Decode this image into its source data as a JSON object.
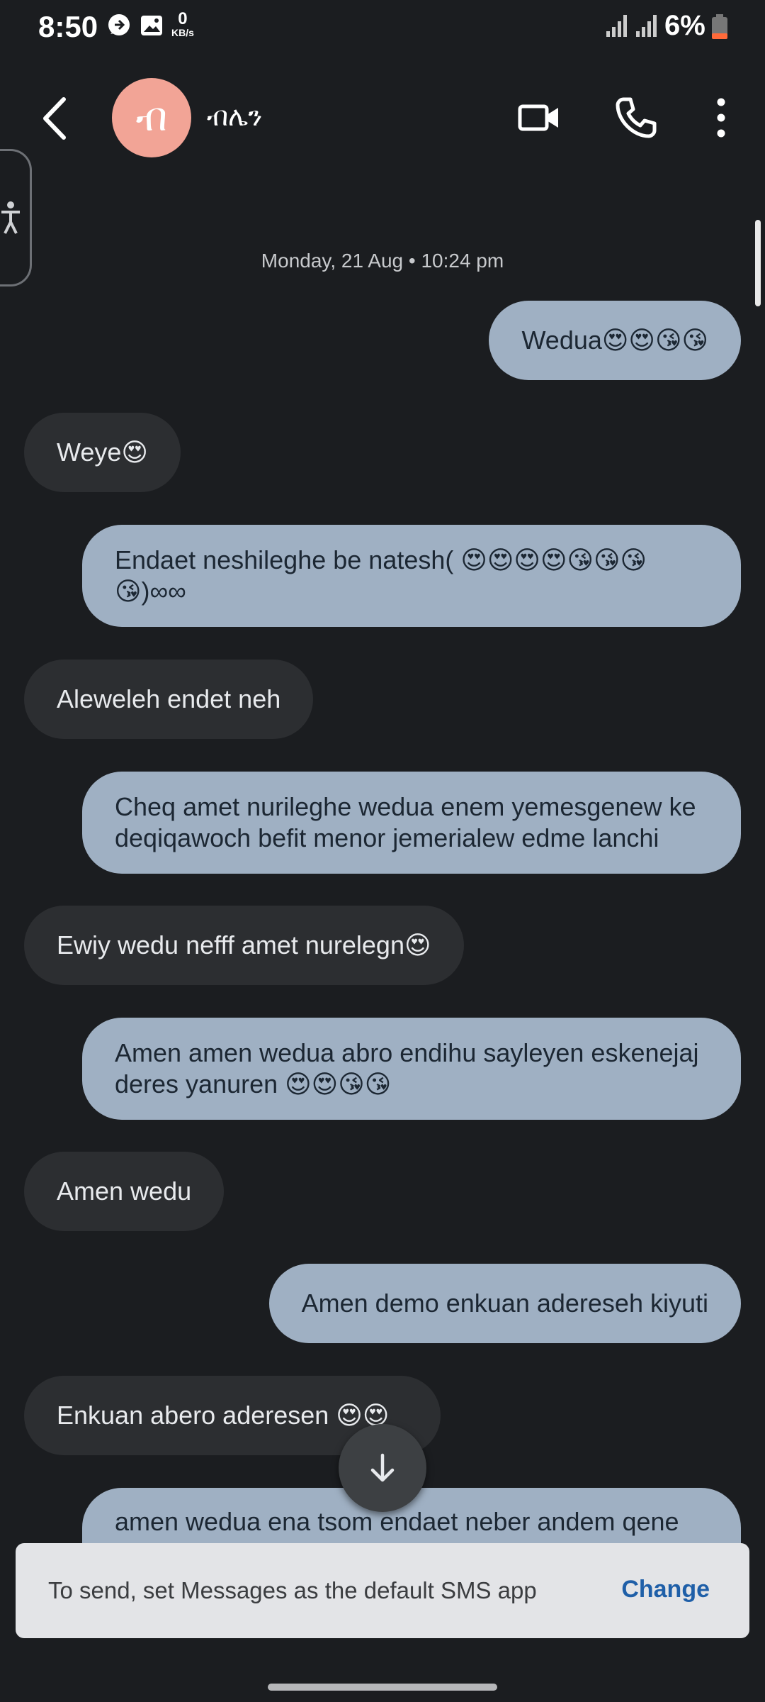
{
  "status_bar": {
    "time": "8:50",
    "net_speed": "0",
    "net_unit": "KB/s",
    "battery": "6%"
  },
  "header": {
    "avatar_letter": "ብ",
    "contact_name": "ብሌን"
  },
  "conversation": {
    "date": "Monday, 21 Aug • 10:24 pm",
    "messages": [
      {
        "dir": "sent",
        "text": "Wedua😍😍😘😘"
      },
      {
        "dir": "recv",
        "text": "Weye😍"
      },
      {
        "dir": "sent",
        "text": "Endaet neshileghe be natesh( 😍😍😍😍😘😘😘 😘)∞∞"
      },
      {
        "dir": "recv",
        "text": "Aleweleh endet neh"
      },
      {
        "dir": "sent",
        "text": "Cheq amet nurileghe wedua enem yemesgenew ke deqiqawoch befit menor jemerialew edme lanchi"
      },
      {
        "dir": "recv",
        "text": "Ewiy wedu nefff amet nurelegn😍"
      },
      {
        "dir": "sent",
        "text": "Amen amen wedua abro endihu sayleyen eskenejaj deres yanuren 😍😍😘😘"
      },
      {
        "dir": "recv",
        "text": "Amen wedu"
      },
      {
        "dir": "sent",
        "text": "Amen demo enkuan adereseh kiyuti"
      },
      {
        "dir": "recv",
        "text": "Enkuan abero aderesen 😍😍"
      },
      {
        "dir": "sent",
        "text": "amen wedua ena tsom endaet neber andem qene"
      }
    ]
  },
  "snackbar": {
    "message": "To send, set Messages as the default SMS app",
    "action": "Change"
  },
  "colors": {
    "background": "#1b1d20",
    "sent_bubble": "#9fb0c3",
    "received_bubble": "#2c2e31",
    "avatar": "#f2a496",
    "action_blue": "#1f5fa8"
  },
  "icons": [
    "message-notification-icon",
    "image-notification-icon",
    "signal-icon",
    "battery-low-icon",
    "back-arrow-icon",
    "video-call-icon",
    "phone-icon",
    "more-options-icon",
    "accessibility-icon",
    "arrow-down-icon"
  ]
}
